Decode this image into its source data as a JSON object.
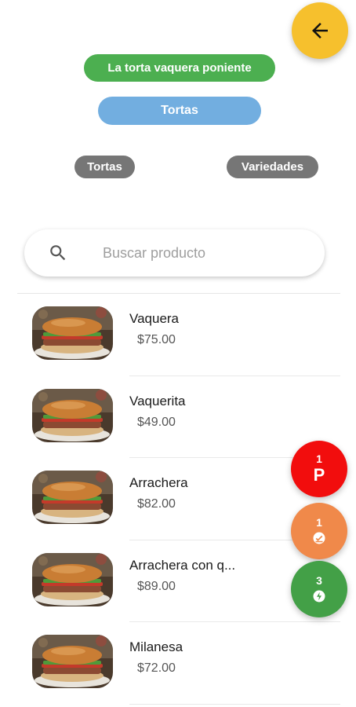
{
  "header": {
    "back_icon": "arrow-back-icon",
    "back_color": "#F6C02D",
    "store_name": "La torta vaquera poniente",
    "store_color": "#4CAF50",
    "category": "Tortas",
    "category_color": "#72AEE0"
  },
  "filters": {
    "chips": [
      "Tortas",
      "Variedades"
    ],
    "chip_color": "#767676"
  },
  "search": {
    "icon": "search-icon",
    "placeholder": "Buscar producto",
    "value": ""
  },
  "products": [
    {
      "name": "Vaquera",
      "price": "$75.00",
      "image": "torta-image"
    },
    {
      "name": "Vaquerita",
      "price": "$49.00",
      "image": "torta-image"
    },
    {
      "name": "Arrachera",
      "price": "$82.00",
      "image": "torta-image"
    },
    {
      "name": "Arrachera con q...",
      "price": "$89.00",
      "image": "torta-image"
    },
    {
      "name": "Milanesa",
      "price": "$72.00",
      "image": "torta-image"
    }
  ],
  "floating_actions": {
    "pending": {
      "count": "1",
      "label": "P",
      "color": "#F20D0D"
    },
    "preparing": {
      "count": "1",
      "icon": "order-ready-icon",
      "color": "#F0894A"
    },
    "delivered": {
      "count": "3",
      "icon": "delivery-icon",
      "color": "#43A047"
    }
  }
}
